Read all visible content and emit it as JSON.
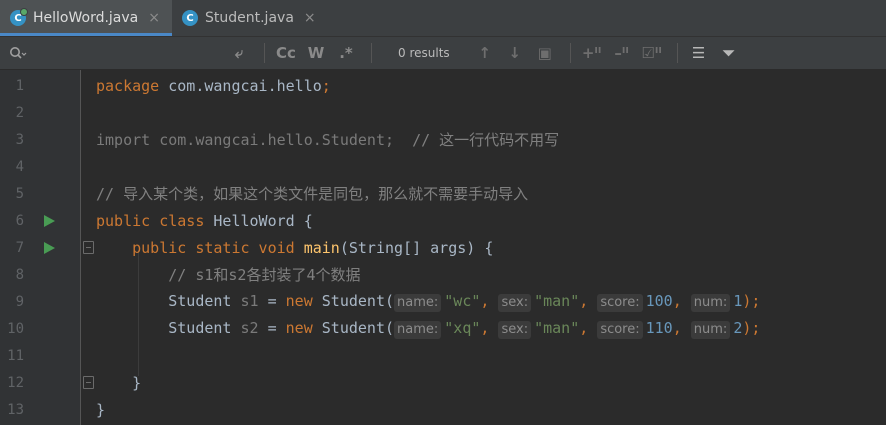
{
  "tabs": [
    {
      "label": "HelloWord.java",
      "icon": "C",
      "active": true,
      "close": "×"
    },
    {
      "label": "Student.java",
      "icon": "C",
      "active": false,
      "close": "×"
    }
  ],
  "findbar": {
    "search_icon": "Q▾",
    "results": "0 results",
    "buttons": [
      "⤶",
      "Cc",
      "W",
      ".*",
      "↑",
      "↓",
      "▣",
      "+ᴵᴵ",
      "–ᴵᴵ",
      "☑ᴵᴵ",
      "☰",
      "⏷"
    ]
  },
  "lines": [
    {
      "n": "1"
    },
    {
      "n": "2"
    },
    {
      "n": "3"
    },
    {
      "n": "4"
    },
    {
      "n": "5"
    },
    {
      "n": "6"
    },
    {
      "n": "7"
    },
    {
      "n": "8"
    },
    {
      "n": "9"
    },
    {
      "n": "10"
    },
    {
      "n": "11"
    },
    {
      "n": "12"
    },
    {
      "n": "13"
    }
  ],
  "code": {
    "l1_kw": "package",
    "l1_rest": " com.wangcai.hello",
    "l1_semi": ";",
    "l3": "import com.wangcai.hello.Student;",
    "l3_cmt": "  // 这一行代码不用写",
    "l5_cmt": "// 导入某个类，如果这个类文件是同包，那么就不需要手动导入",
    "l6_kw": "public class",
    "l6_rest": " HelloWord {",
    "l7_kw": "    public static void",
    "l7_fn": " main",
    "l7_rest": "(String[] args) {",
    "l8_cmt": "        // s1和s2各封装了4个数据",
    "l9_a": "        Student ",
    "l9_var": "s1",
    "l9_eq": " = ",
    "l9_new": "new",
    "l9_cls": " Student(",
    "l9_h1": "name:",
    "l9_v1": "\"wc\"",
    "l9_h2": "sex:",
    "l9_v2": "\"man\"",
    "l9_h3": "score:",
    "l9_v3": "100",
    "l9_h4": "num:",
    "l9_v4": "1",
    "l10_a": "        Student ",
    "l10_var": "s2",
    "l10_eq": " = ",
    "l10_new": "new",
    "l10_cls": " Student(",
    "l10_h1": "name:",
    "l10_v1": "\"xq\"",
    "l10_h2": "sex:",
    "l10_v2": "\"man\"",
    "l10_h3": "score:",
    "l10_v3": "110",
    "l10_h4": "num:",
    "l10_v4": "2",
    "comma": ", ",
    "end": ");",
    "l12": "    }",
    "l13": "}"
  },
  "colors": {
    "keyword": "#cc7832",
    "string": "#6a8759",
    "number": "#6897bb",
    "comment": "#808080",
    "method": "#ffc66d",
    "run": "#499c54"
  }
}
